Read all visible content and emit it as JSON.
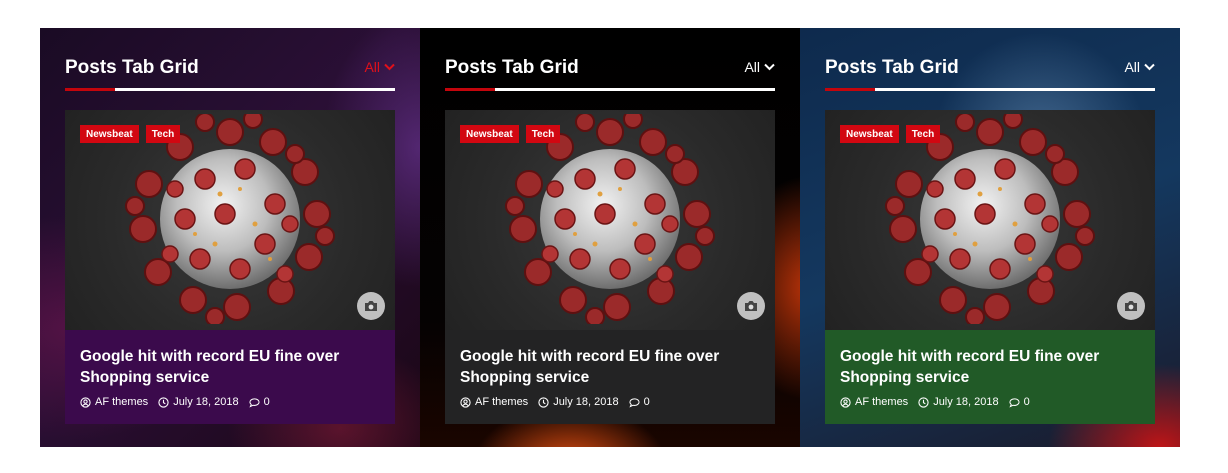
{
  "colors": {
    "accent_red": "#c4050c",
    "category_red": "#d20711",
    "panel1_card": "#3b0a4c",
    "panel2_card": "#232324",
    "panel3_card": "#215a27",
    "panel1_filter": "#e0101a",
    "panel2_filter": "#ffffff",
    "panel3_filter": "#ffffff"
  },
  "panels": [
    {
      "heading": "Posts Tab Grid",
      "filter": "All",
      "filter_icon": "chevron-down-icon",
      "categories": [
        "Newsbeat",
        "Tech"
      ],
      "media_icon": "camera-icon",
      "post": {
        "title": "Google hit with record EU fine over Shopping service",
        "author": "AF themes",
        "date": "July 18, 2018",
        "comments": "0"
      }
    },
    {
      "heading": "Posts Tab Grid",
      "filter": "All",
      "filter_icon": "chevron-down-icon",
      "categories": [
        "Newsbeat",
        "Tech"
      ],
      "media_icon": "camera-icon",
      "post": {
        "title": "Google hit with record EU fine over Shopping service",
        "author": "AF themes",
        "date": "July 18, 2018",
        "comments": "0"
      }
    },
    {
      "heading": "Posts Tab Grid",
      "filter": "All",
      "filter_icon": "chevron-down-icon",
      "categories": [
        "Newsbeat",
        "Tech"
      ],
      "media_icon": "camera-icon",
      "post": {
        "title": "Google hit with record EU fine over Shopping service",
        "author": "AF themes",
        "date": "July 18, 2018",
        "comments": "0"
      }
    }
  ]
}
